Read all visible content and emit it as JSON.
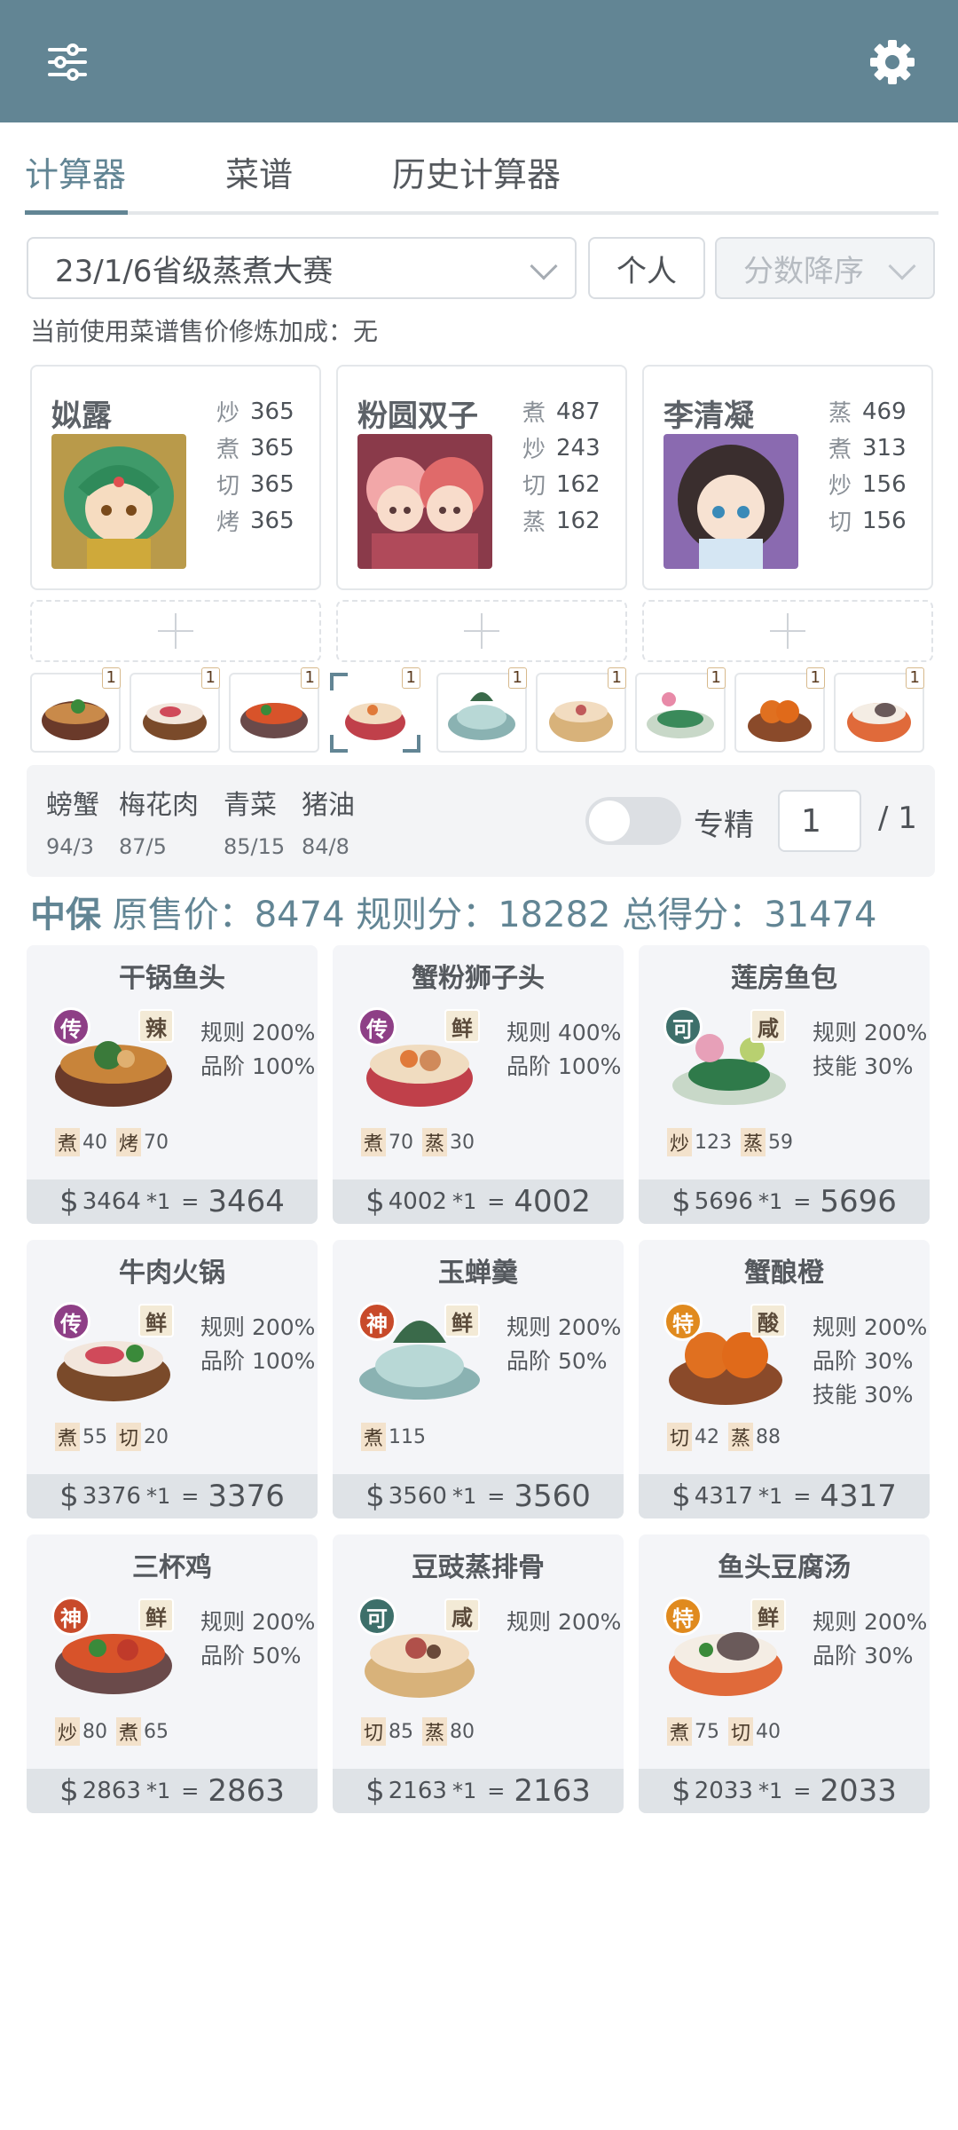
{
  "toolbar": {
    "filter_icon": "sliders-icon",
    "settings_icon": "gear-icon"
  },
  "tabs": [
    {
      "label": "计算器",
      "active": true
    },
    {
      "label": "菜谱",
      "active": false
    },
    {
      "label": "历史计算器",
      "active": false
    }
  ],
  "controls": {
    "contest": "23/1/6省级蒸煮大赛",
    "mode": "个人",
    "sort": "分数降序"
  },
  "bonus_text": "当前使用菜谱售价修炼加成：无",
  "chefs": [
    {
      "name": "姒露",
      "skills": [
        {
          "k": "炒",
          "v": "365"
        },
        {
          "k": "煮",
          "v": "365"
        },
        {
          "k": "切",
          "v": "365"
        },
        {
          "k": "烤",
          "v": "365"
        }
      ]
    },
    {
      "name": "粉圆双子",
      "skills": [
        {
          "k": "煮",
          "v": "487"
        },
        {
          "k": "炒",
          "v": "243"
        },
        {
          "k": "切",
          "v": "162"
        },
        {
          "k": "蒸",
          "v": "162"
        }
      ]
    },
    {
      "name": "李清凝",
      "skills": [
        {
          "k": "蒸",
          "v": "469"
        },
        {
          "k": "煮",
          "v": "313"
        },
        {
          "k": "炒",
          "v": "156"
        },
        {
          "k": "切",
          "v": "156"
        }
      ]
    }
  ],
  "dish_counts": [
    "1",
    "1",
    "1",
    "1",
    "1",
    "1",
    "1",
    "1",
    "1"
  ],
  "ingredients": [
    {
      "name": "螃蟹",
      "qty": "94/3"
    },
    {
      "name": "梅花肉",
      "qty": "87/5"
    },
    {
      "name": "青菜",
      "qty": "85/15"
    },
    {
      "name": "猪油",
      "qty": "84/8"
    }
  ],
  "specialty": {
    "label": "专精",
    "value": "1",
    "denominator": "/ 1",
    "enabled": false
  },
  "summary": {
    "tag": "中保",
    "text": "原售价：8474 规则分：18282 总得分：31474"
  },
  "recipes": [
    {
      "name": "干锅鱼头",
      "rarity": "传",
      "rarity_color": "#8e3f86",
      "flavor": "辣",
      "rules": [
        "规则 200%",
        "品阶 100%"
      ],
      "reqs": [
        {
          "k": "煮",
          "v": "40"
        },
        {
          "k": "烤",
          "v": "70"
        }
      ],
      "price": "3464",
      "mult": "*1",
      "total": "3464"
    },
    {
      "name": "蟹粉狮子头",
      "rarity": "传",
      "rarity_color": "#8e3f86",
      "flavor": "鲜",
      "rules": [
        "规则 400%",
        "品阶 100%"
      ],
      "reqs": [
        {
          "k": "煮",
          "v": "70"
        },
        {
          "k": "蒸",
          "v": "30"
        }
      ],
      "price": "4002",
      "mult": "*1",
      "total": "4002"
    },
    {
      "name": "莲房鱼包",
      "rarity": "可",
      "rarity_color": "#3d6f6a",
      "flavor": "咸",
      "rules": [
        "规则 200%",
        "技能 30%"
      ],
      "reqs": [
        {
          "k": "炒",
          "v": "123"
        },
        {
          "k": "蒸",
          "v": "59"
        }
      ],
      "price": "5696",
      "mult": "*1",
      "total": "5696"
    },
    {
      "name": "牛肉火锅",
      "rarity": "传",
      "rarity_color": "#8e3f86",
      "flavor": "鲜",
      "rules": [
        "规则 200%",
        "品阶 100%"
      ],
      "reqs": [
        {
          "k": "煮",
          "v": "55"
        },
        {
          "k": "切",
          "v": "20"
        }
      ],
      "price": "3376",
      "mult": "*1",
      "total": "3376"
    },
    {
      "name": "玉蝉羹",
      "rarity": "神",
      "rarity_color": "#c84a2a",
      "flavor": "鲜",
      "rules": [
        "规则 200%",
        "品阶 50%"
      ],
      "reqs": [
        {
          "k": "煮",
          "v": "115"
        }
      ],
      "price": "3560",
      "mult": "*1",
      "total": "3560"
    },
    {
      "name": "蟹酿橙",
      "rarity": "特",
      "rarity_color": "#e08a1e",
      "flavor": "酸",
      "rules": [
        "规则 200%",
        "品阶 30%",
        "技能 30%"
      ],
      "reqs": [
        {
          "k": "切",
          "v": "42"
        },
        {
          "k": "蒸",
          "v": "88"
        }
      ],
      "price": "4317",
      "mult": "*1",
      "total": "4317"
    },
    {
      "name": "三杯鸡",
      "rarity": "神",
      "rarity_color": "#c84a2a",
      "flavor": "鲜",
      "rules": [
        "规则 200%",
        "品阶 50%"
      ],
      "reqs": [
        {
          "k": "炒",
          "v": "80"
        },
        {
          "k": "煮",
          "v": "65"
        }
      ],
      "price": "2863",
      "mult": "*1",
      "total": "2863"
    },
    {
      "name": "豆豉蒸排骨",
      "rarity": "可",
      "rarity_color": "#3d6f6a",
      "flavor": "咸",
      "rules": [
        "规则 200%"
      ],
      "reqs": [
        {
          "k": "切",
          "v": "85"
        },
        {
          "k": "蒸",
          "v": "80"
        }
      ],
      "price": "2163",
      "mult": "*1",
      "total": "2163"
    },
    {
      "name": "鱼头豆腐汤",
      "rarity": "特",
      "rarity_color": "#e08a1e",
      "flavor": "鲜",
      "rules": [
        "规则 200%",
        "品阶 30%"
      ],
      "reqs": [
        {
          "k": "煮",
          "v": "75"
        },
        {
          "k": "切",
          "v": "40"
        }
      ],
      "price": "2033",
      "mult": "*1",
      "total": "2033"
    }
  ]
}
